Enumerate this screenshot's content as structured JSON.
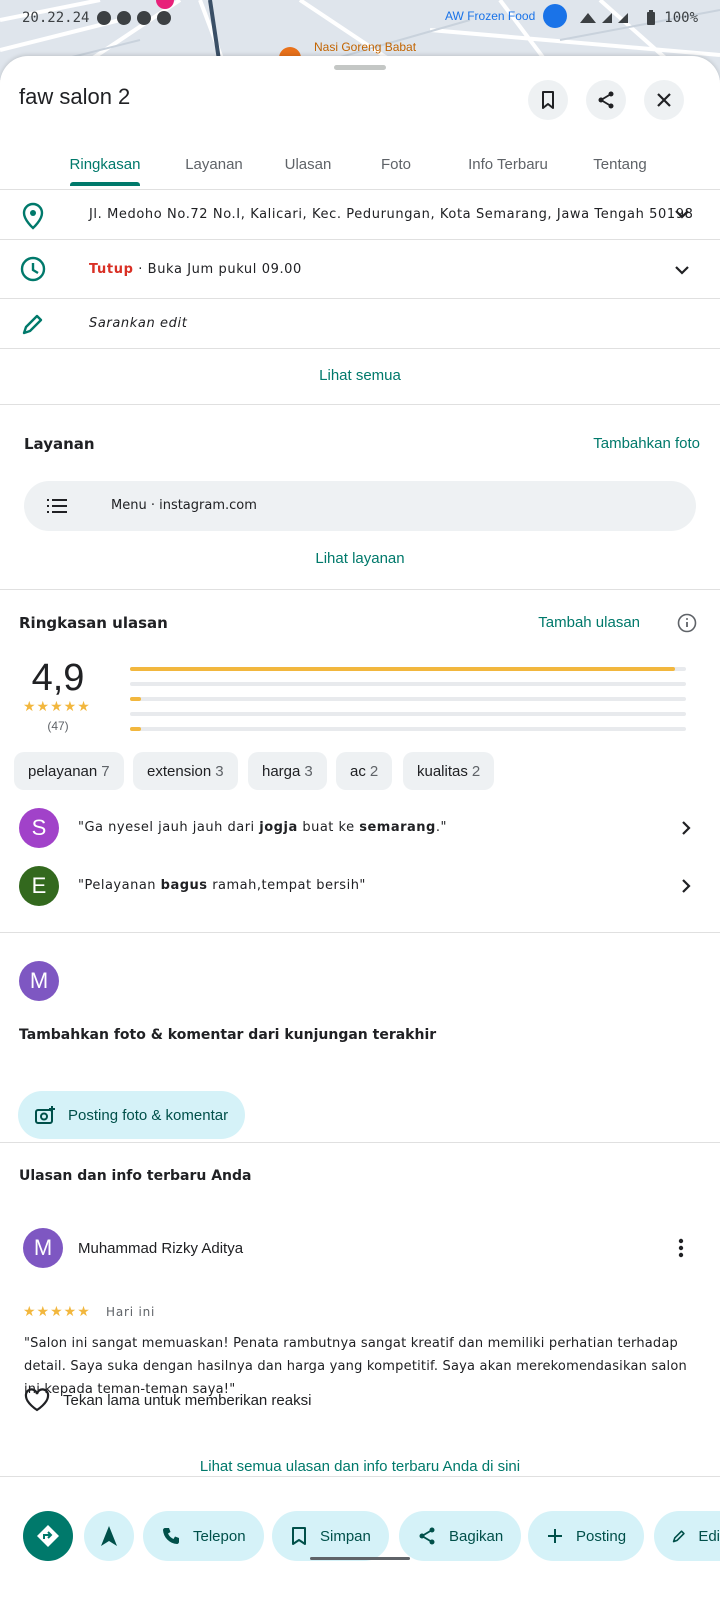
{
  "status": {
    "time": "20.22.24",
    "battery": "100%"
  },
  "map": {
    "label1": "Nasi Goreng Babat",
    "label2": "AW Frozen Food"
  },
  "place": {
    "name": "faw salon 2"
  },
  "tabs": [
    "Ringkasan",
    "Layanan",
    "Ulasan",
    "Foto",
    "Info Terbaru",
    "Tentang"
  ],
  "info": {
    "address": "Jl. Medoho No.72 No.I, Kalicari, Kec. Pedurungan, Kota Semarang, Jawa Tengah 50198",
    "status_closed": "Tutup",
    "status_rest": " · Buka Jum pukul 09.00",
    "suggest": "Sarankan edit",
    "see_all": "Lihat semua"
  },
  "services": {
    "title": "Layanan",
    "add_photo": "Tambahkan foto",
    "menu_label": "Menu · instagram.com",
    "see_services": "Lihat layanan"
  },
  "reviews_summary": {
    "title": "Ringkasan ulasan",
    "add_review": "Tambah ulasan",
    "rating": "4,9",
    "stars": "★★★★★",
    "count": "(47)",
    "distribution": [
      0.98,
      0.0,
      0.02,
      0.0,
      0.02
    ],
    "chips": [
      {
        "label": "pelayanan",
        "count": "7"
      },
      {
        "label": "extension",
        "count": "3"
      },
      {
        "label": "harga",
        "count": "3"
      },
      {
        "label": "ac",
        "count": "2"
      },
      {
        "label": "kualitas",
        "count": "2"
      }
    ],
    "snippets": [
      {
        "initial": "S",
        "pre": "\"Ga nyesel jauh jauh dari ",
        "b1": "jogja",
        "mid": " buat ke ",
        "b2": "semarang",
        "post": ".\"",
        "color": "#a142c9"
      },
      {
        "initial": "E",
        "pre": "\"Pelayanan ",
        "b1": "bagus",
        "mid": " ramah,tempat bersih\"",
        "b2": "",
        "post": "",
        "color": "#33691e"
      }
    ]
  },
  "add_visit": {
    "initial": "M",
    "title": "Tambahkan foto & komentar dari kunjungan terakhir",
    "button": "Posting foto & komentar"
  },
  "my_reviews": {
    "title": "Ulasan dan info terbaru Anda",
    "author": "Muhammad Rizky Aditya",
    "initial": "M",
    "stars": "★★★★★",
    "date": "Hari ini",
    "text": "\"Salon ini sangat memuaskan! Penata rambutnya sangat kreatif dan memiliki perhatian terhadap detail. Saya suka dengan hasilnya dan harga yang kompetitif. Saya akan merekomendasikan salon ini kepada teman-teman saya!\"",
    "react": "Tekan lama untuk memberikan reaksi",
    "see_all": "Lihat semua ulasan dan info terbaru Anda di sini"
  },
  "actions": [
    "Telepon",
    "Simpan",
    "Bagikan",
    "Posting",
    "Edi"
  ],
  "colors": {
    "accent": "#00796b",
    "chip_bg": "#d5f2f8",
    "closed": "#d93025",
    "star": "#f2b73e"
  }
}
